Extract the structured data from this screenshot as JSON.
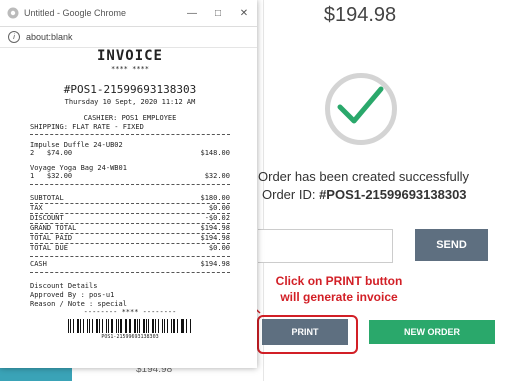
{
  "pos": {
    "total": "$194.98",
    "success_msg": "Order has been created successfully",
    "order_label": "Order ID: ",
    "order_id": "#POS1-21599693138303",
    "send_label": "SEND",
    "print_label": "PRINT",
    "new_order_label": "NEW ORDER",
    "annotation_line1": "Click on PRINT button",
    "annotation_line2": "will generate invoice",
    "left_partial_text": "$194.98"
  },
  "browser": {
    "title": "Untitled - Google Chrome",
    "url": "about:blank"
  },
  "receipt": {
    "heading": "INVOICE",
    "stars": "**** ****",
    "id": "#POS1-21599693138303",
    "date": "Thursday 10 Sept, 2020 11:12 AM",
    "cashier": "CASHIER: POS1 EMPLOYEE",
    "shipping": "SHIPPING: FLAT RATE - FIXED",
    "items": [
      {
        "name": "Impulse Duffle 24-UB02",
        "qty_price": "2   $74.00",
        "total": "$148.00"
      },
      {
        "name": "Voyage Yoga Bag 24-WB01",
        "qty_price": "1   $32.00",
        "total": "$32.00"
      }
    ],
    "totals": [
      {
        "label": "SUBTOTAL",
        "value": "$180.00"
      },
      {
        "label": "TAX",
        "value": "$0.00"
      },
      {
        "label": "DISCOUNT",
        "value": "-$0.02"
      },
      {
        "label": "GRAND TOTAL",
        "value": "$194.98"
      },
      {
        "label": "TOTAL PAID",
        "value": "$194.98"
      },
      {
        "label": "TOTAL DUE",
        "value": "$0.00"
      }
    ],
    "cash_label": "CASH",
    "cash_value": "$194.98",
    "discount_heading": "Discount Details",
    "approved": "Approved By : pos-u1",
    "reason": "Reason / Note : special",
    "footer_stars": "-------- **** --------",
    "barcode_number": "POS1-21599693138303"
  },
  "colors": {
    "accent_red": "#d21f26",
    "send_gray": "#5e6f80",
    "new_order_green": "#2aa86b",
    "teal": "#3aa3b7"
  }
}
